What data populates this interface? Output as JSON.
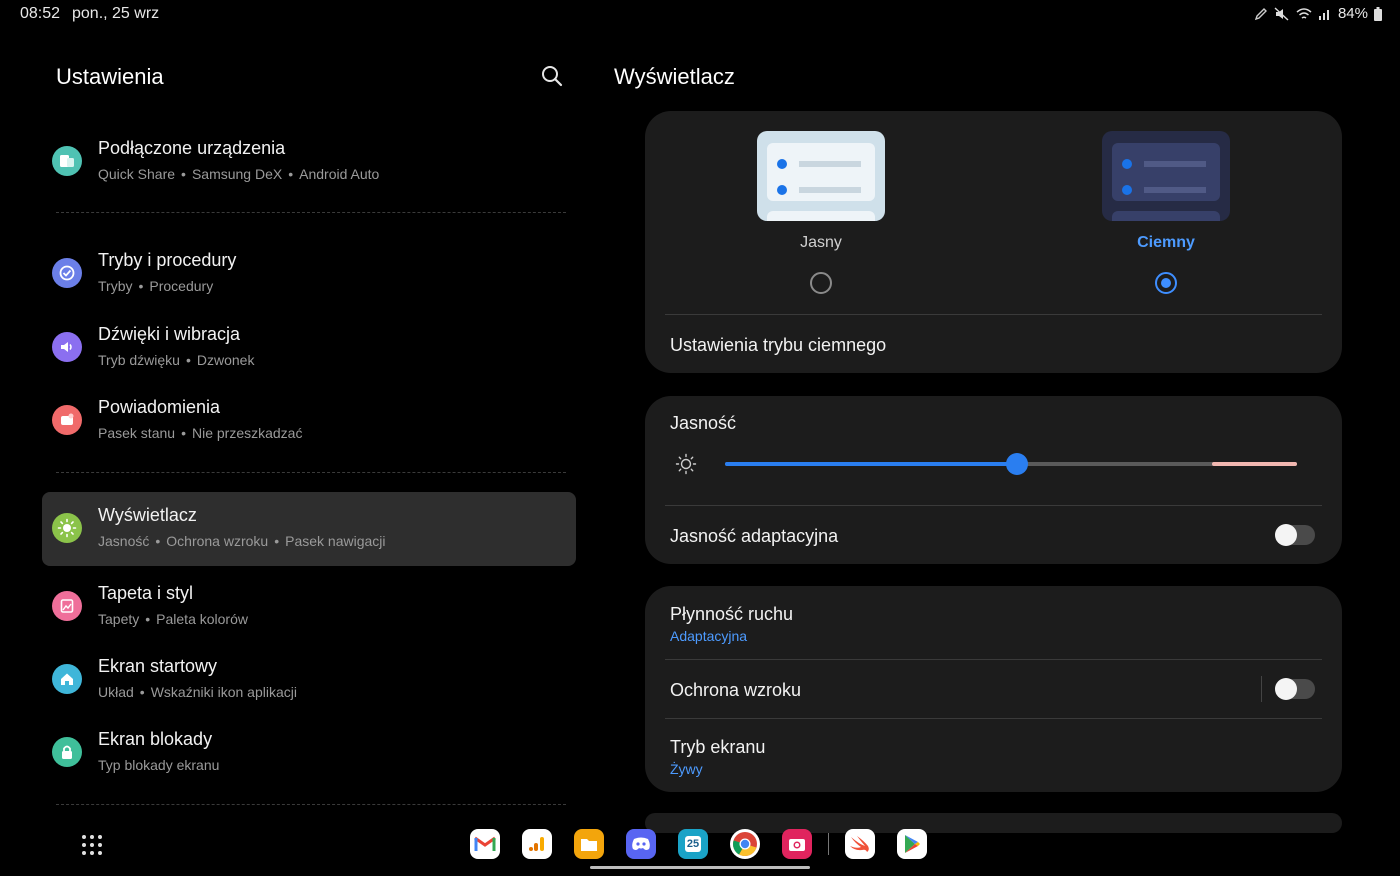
{
  "status_bar": {
    "time": "08:52",
    "date": "pon., 25 wrz",
    "battery": "84%",
    "icons": [
      "pen-icon",
      "mute-icon",
      "wifi-icon",
      "signal-icon",
      "battery-icon"
    ]
  },
  "settings": {
    "title": "Ustawienia",
    "items": [
      {
        "label": "Podłączone urządzenia",
        "sub": [
          "Quick Share",
          "Samsung DeX",
          "Android Auto"
        ],
        "icon": "devices-icon",
        "color": "#4fc2b3"
      },
      {
        "label": "Tryby i procedury",
        "sub": [
          "Tryby",
          "Procedury"
        ],
        "icon": "check-circle-icon",
        "color": "#6b7fe8"
      },
      {
        "label": "Dźwięki i wibracja",
        "sub": [
          "Tryb dźwięku",
          "Dzwonek"
        ],
        "icon": "speaker-icon",
        "color": "#8b6ff0"
      },
      {
        "label": "Powiadomienia",
        "sub": [
          "Pasek stanu",
          "Nie przeszkadzać"
        ],
        "icon": "notification-icon",
        "color": "#f06a6a"
      },
      {
        "label": "Wyświetlacz",
        "sub": [
          "Jasność",
          "Ochrona wzroku",
          "Pasek nawigacji"
        ],
        "icon": "sun-icon",
        "color": "#8bc34a",
        "active": true
      },
      {
        "label": "Tapeta i styl",
        "sub": [
          "Tapety",
          "Paleta kolorów"
        ],
        "icon": "wallpaper-icon",
        "color": "#ef6f9a"
      },
      {
        "label": "Ekran startowy",
        "sub": [
          "Układ",
          "Wskaźniki ikon aplikacji"
        ],
        "icon": "home-icon",
        "color": "#3fb6d9"
      },
      {
        "label": "Ekran blokady",
        "sub": [
          "Typ blokady ekranu"
        ],
        "icon": "lock-icon",
        "color": "#3fbf9a"
      }
    ]
  },
  "display": {
    "title": "Wyświetlacz",
    "modes": [
      {
        "label": "Jasny",
        "selected": false
      },
      {
        "label": "Ciemny",
        "selected": true
      }
    ],
    "dark_mode_settings": "Ustawienia trybu ciemnego",
    "brightness": {
      "label": "Jasność",
      "level": 0.51
    },
    "adaptive_brightness": {
      "label": "Jasność adaptacyjna",
      "on": false
    },
    "motion_smoothness": {
      "label": "Płynność ruchu",
      "value": "Adaptacyjna"
    },
    "eye_comfort": {
      "label": "Ochrona wzroku",
      "on": false
    },
    "screen_mode": {
      "label": "Tryb ekranu",
      "value": "Żywy"
    }
  },
  "dock": {
    "apps": [
      "gmail-icon",
      "analytics-icon",
      "files-icon",
      "discord-icon",
      "calendar-icon",
      "chrome-icon",
      "camera-icon",
      "swift-icon",
      "play-store-icon"
    ],
    "calendar_day": "25"
  },
  "colors": {
    "accent": "#3e8eff",
    "card_bg": "#1c1c1c",
    "active_item_bg": "#2e2e2e"
  }
}
